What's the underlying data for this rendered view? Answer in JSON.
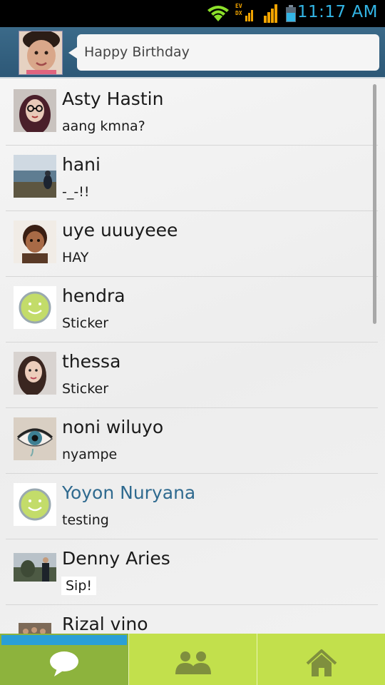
{
  "status_bar": {
    "time": "11:17 AM",
    "net_label_1": "EV",
    "net_label_2": "DX"
  },
  "header": {
    "status_message": "Happy Birthday"
  },
  "chats": [
    {
      "name": "Asty Hastin",
      "message": "aang kmna?",
      "unread": false,
      "avatar": "photo-woman-glasses"
    },
    {
      "name": "hani",
      "message": "-_-!!",
      "unread": false,
      "avatar": "photo-beach"
    },
    {
      "name": "uye uuuyeee",
      "message": "HAY",
      "unread": false,
      "avatar": "photo-child"
    },
    {
      "name": "hendra",
      "message": "Sticker",
      "unread": false,
      "avatar": "smiley-icon"
    },
    {
      "name": "thessa",
      "message": "Sticker",
      "unread": false,
      "avatar": "photo-woman"
    },
    {
      "name": "noni wiluyo",
      "message": "nyampe",
      "unread": false,
      "avatar": "photo-eye"
    },
    {
      "name": "Yoyon Nuryana",
      "message": "testing",
      "unread": true,
      "avatar": "smiley-icon"
    },
    {
      "name": "Denny Aries",
      "message": "Sip!",
      "unread": false,
      "avatar": "photo-group"
    },
    {
      "name": "Rizal vino",
      "message": "",
      "unread": false,
      "avatar": "photo-family"
    }
  ],
  "colors": {
    "header": "#2d5877",
    "accent_blue": "#2a9fd6",
    "nav_green": "#c2e04c",
    "nav_active": "#8db33d",
    "unread_name": "#2f6a8f"
  },
  "bottom_nav": {
    "tabs": [
      {
        "icon": "chat-bubble-icon",
        "active": true
      },
      {
        "icon": "contacts-icon",
        "active": false
      },
      {
        "icon": "home-icon",
        "active": false
      }
    ]
  }
}
